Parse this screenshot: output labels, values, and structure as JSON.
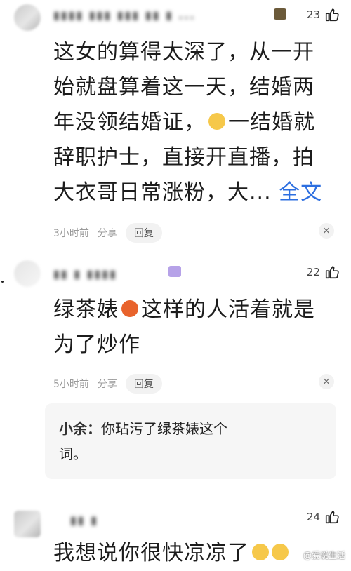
{
  "comments": [
    {
      "likes": "23",
      "text_lines": [
        "这女的算得太深了，从一开",
        "始就盘算着这一天，结婚两",
        "年没领结婚证，",
        "辞职护士，直接开直播，拍",
        "大衣哥日常涨粉，大..."
      ],
      "line3_after": "一结婚就",
      "expand_label": "全文",
      "time": "3小时前",
      "share_label": "分享",
      "reply_label": "回复",
      "dismiss_icon": "×"
    },
    {
      "likes": "22",
      "text_before": "绿茶婊",
      "text_after": "这样的人活着就是",
      "text_line2": "为了炒作",
      "time": "5小时前",
      "share_label": "分享",
      "reply_label": "回复",
      "dismiss_icon": "×",
      "reply": {
        "author": "小余：",
        "text_line1": "你玷污了绿茶婊这个",
        "text_line2": "词。"
      }
    },
    {
      "likes": "24",
      "text": "我想说你很快凉凉了"
    }
  ],
  "watermark": "@爱说生活",
  "colors": {
    "link": "#2d6fe0",
    "meta": "#9a9a9a",
    "reply_bg": "#f6f6f6"
  },
  "icons": [
    "thumb-up-icon",
    "close-icon",
    "emoji-icon"
  ]
}
